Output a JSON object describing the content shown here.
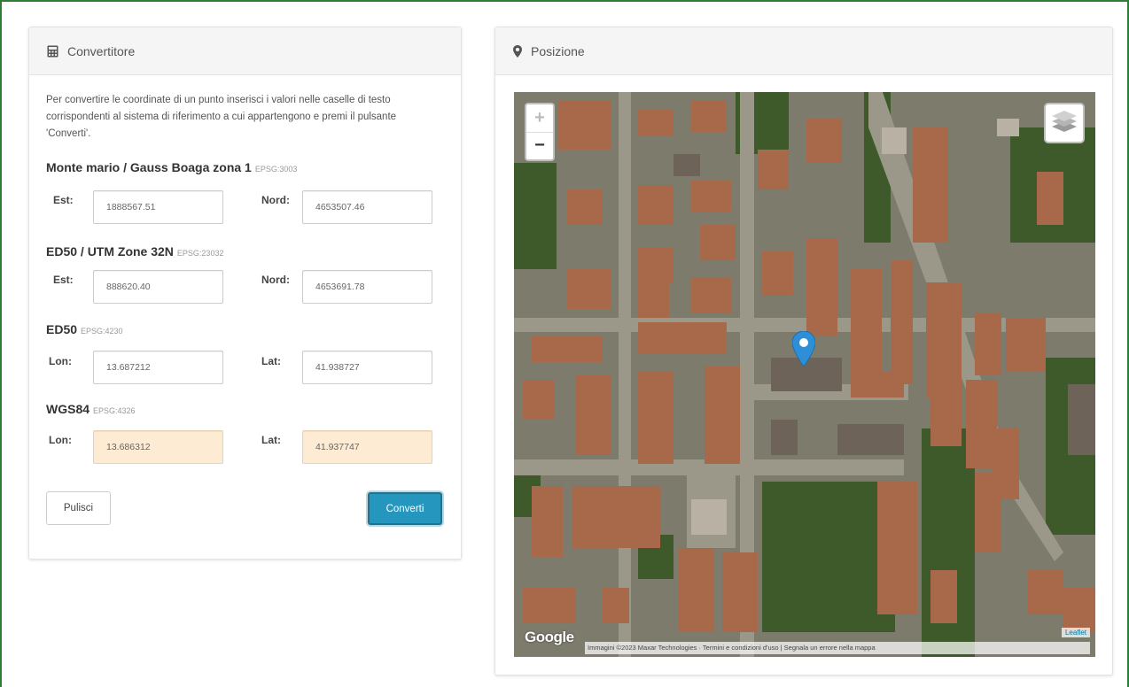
{
  "converter": {
    "title": "Convertitore",
    "icon": "calculator-icon",
    "intro": "Per convertire le coordinate di un punto inserisci i valori nelle caselle di testo corrispondenti al sistema di riferimento a cui appartengono e premi il pulsante 'Converti'.",
    "sections": [
      {
        "name": "Monte mario / Gauss Boaga zona 1",
        "epsg": "EPSG:3003",
        "label1": "Est:",
        "value1": "1888567.51",
        "label2": "Nord:",
        "value2": "4653507.46"
      },
      {
        "name": "ED50 / UTM Zone 32N",
        "epsg": "EPSG:23032",
        "label1": "Est:",
        "value1": "888620.40",
        "label2": "Nord:",
        "value2": "4653691.78"
      },
      {
        "name": "ED50",
        "epsg": "EPSG:4230",
        "label1": "Lon:",
        "value1": "13.687212",
        "label2": "Lat:",
        "value2": "41.938727"
      },
      {
        "name": "WGS84",
        "epsg": "EPSG:4326",
        "label1": "Lon:",
        "value1": "13.686312",
        "label2": "Lat:",
        "value2": "41.937747"
      }
    ],
    "clear_label": "Pulisci",
    "convert_label": "Converti"
  },
  "position": {
    "title": "Posizione",
    "icon": "map-marker-icon",
    "zoom_in": "+",
    "zoom_out": "−",
    "google_logo": "Google",
    "attribution": "Immagini ©2023 Maxar Technologies · Termini e condizioni d'uso | Segnala un errore nella mappa",
    "leaflet": "Leaflet"
  },
  "colors": {
    "frame": "#2e7d32",
    "accent_button": "#2596be",
    "result_field": "#fdebd3",
    "marker": "#2f8fd6"
  }
}
